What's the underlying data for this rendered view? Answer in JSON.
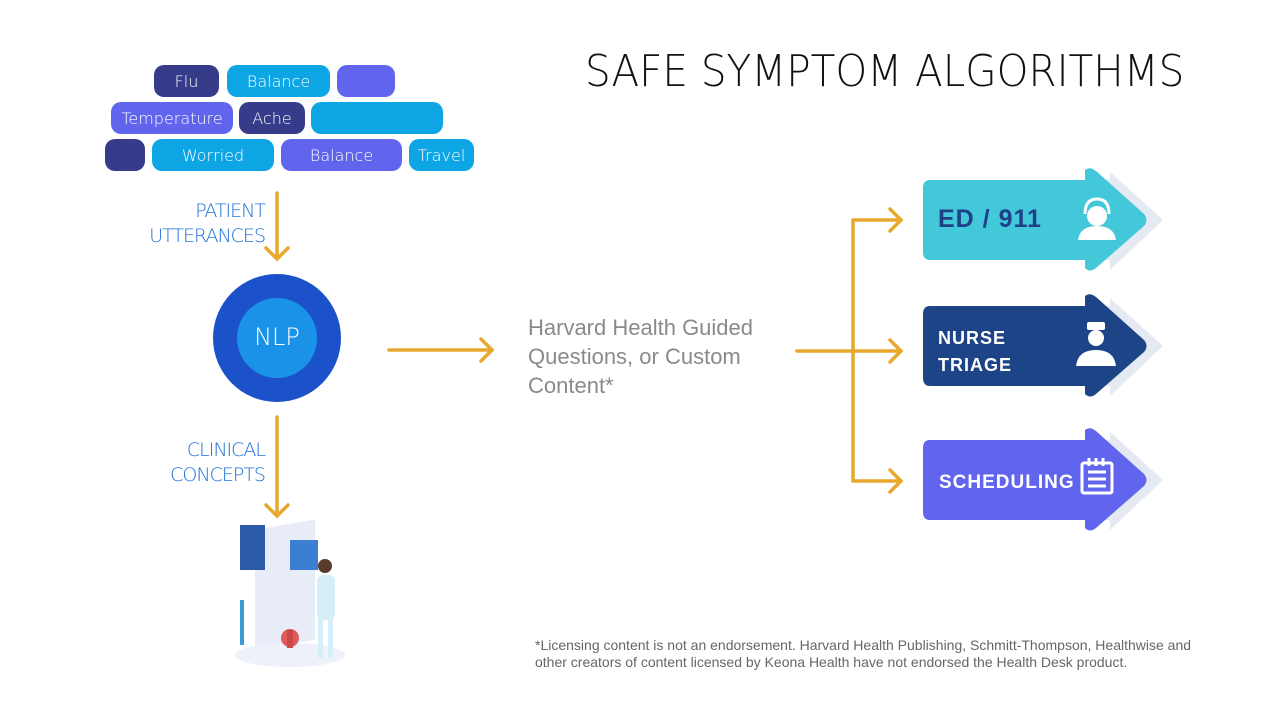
{
  "title": "SAFE SYMPTOM ALGORITHMS",
  "pills": [
    {
      "label": "Flu",
      "color": "dark"
    },
    {
      "label": "Balance",
      "color": "cyan"
    },
    {
      "label": "",
      "color": "violet"
    },
    {
      "label": "Temperature",
      "color": "violet"
    },
    {
      "label": "Ache",
      "color": "dark"
    },
    {
      "label": "",
      "color": "cyan"
    },
    {
      "label": "",
      "color": "dark"
    },
    {
      "label": "Worried",
      "color": "cyan"
    },
    {
      "label": "Balance",
      "color": "violet"
    },
    {
      "label": "Travel",
      "color": "cyan"
    }
  ],
  "labels": {
    "utterances_1": "PATIENT",
    "utterances_2": "UTTERANCES",
    "concepts_1": "CLINICAL",
    "concepts_2": "CONCEPTS"
  },
  "nlp": "NLP",
  "content_text": "Harvard Health Guided Questions, or Custom Content*",
  "outcomes": [
    {
      "label": "ED / 911",
      "icon": "headset-agent-icon",
      "color": "#43c8da",
      "text_color": "#1f3f86"
    },
    {
      "label_1": "NURSE",
      "label_2": "TRIAGE",
      "icon": "nurse-icon",
      "color": "#1d4487",
      "text_color": "#ffffff"
    },
    {
      "label": "SCHEDULING",
      "icon": "calendar-icon",
      "color": "#6165ee",
      "text_color": "#ffffff"
    }
  ],
  "footnote": "*Licensing content is not an endorsement. Harvard Health Publishing, Schmitt-Thompson, Healthwise and other creators of content licensed by Keona Health have not endorsed the Health Desk product.",
  "colors": {
    "arrow": "#e8a82e",
    "label_blue": "#1e6fd9"
  }
}
